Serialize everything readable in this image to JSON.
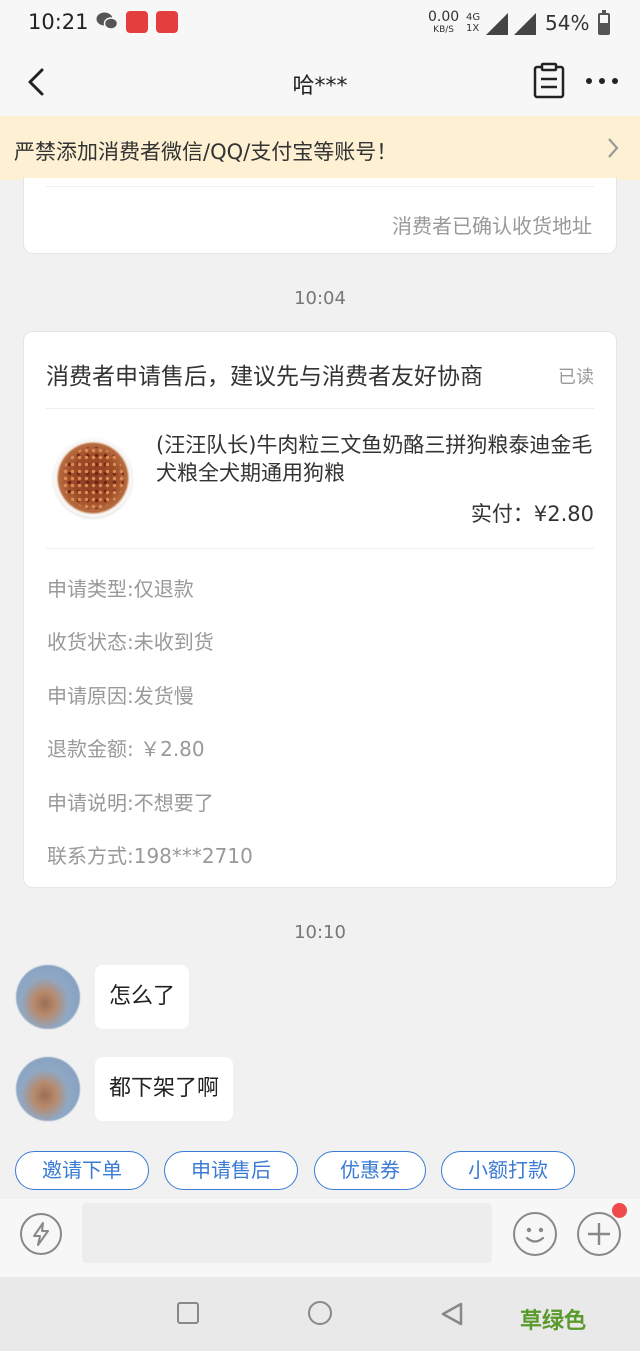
{
  "status_bar": {
    "time": "10:21",
    "net_speed_value": "0.00",
    "net_speed_unit": "KB/S",
    "network_top": "4G",
    "network_bottom": "1X",
    "battery_text": "54%",
    "battery_level": 0.54
  },
  "nav": {
    "title": "哈***"
  },
  "banner": {
    "text": "严禁添加消费者微信/QQ/支付宝等账号！"
  },
  "address_card": {
    "status": "消费者已确认收货地址"
  },
  "timestamps": [
    "10:04",
    "10:10"
  ],
  "aftersale_card": {
    "title": "消费者申请售后，建议先与消费者友好协商",
    "read_status": "已读",
    "product_name": "(汪汪队长)牛肉粒三文鱼奶酪三拼狗粮泰迪金毛犬粮全犬期通用狗粮",
    "paid": "实付：¥2.80",
    "details": [
      "申请类型:仅退款",
      "收货状态:未收到货",
      "申请原因:发货慢",
      "退款金额: ￥2.80",
      "申请说明:不想要了",
      "联系方式:198***2710"
    ]
  },
  "messages": [
    {
      "text": "怎么了"
    },
    {
      "text": "都下架了啊"
    }
  ],
  "quick_actions": [
    "邀请下单",
    "申请售后",
    "优惠券",
    "小额打款"
  ],
  "input": {
    "placeholder": ""
  },
  "watermark": "草绿色",
  "colors": {
    "accent": "#3a7bd5",
    "banner_bg": "#fdf0d3",
    "badge_red": "#f04b4b",
    "watermark_green": "#5a9a2c"
  },
  "icons": [
    "wechat-icon",
    "app-notification-icon",
    "back-arrow-icon",
    "order-clipboard-icon",
    "more-icon",
    "chevron-right-icon",
    "flash-icon",
    "emoji-icon",
    "plus-icon",
    "square-icon",
    "circle-icon",
    "triangle-back-icon"
  ]
}
